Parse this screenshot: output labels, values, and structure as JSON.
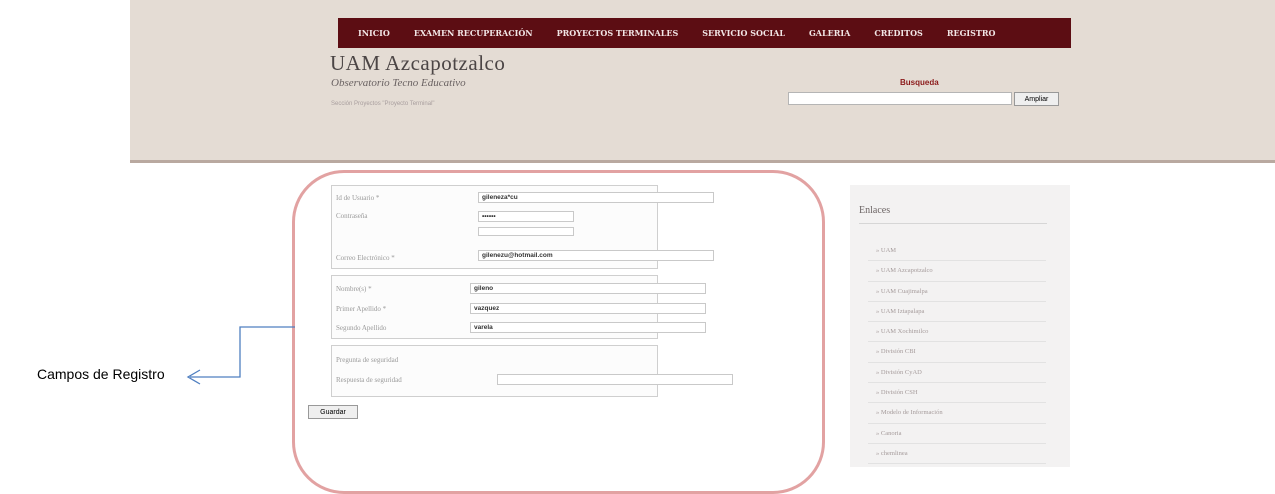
{
  "nav": {
    "items": [
      "INICIO",
      "EXAMEN RECUPERACIÓN",
      "PROYECTOS TERMINALES",
      "SERVICIO SOCIAL",
      "GALERIA",
      "CREDITOS",
      "REGISTRO"
    ]
  },
  "site": {
    "title": "UAM Azcapotzalco",
    "subtitle": "Observatorio Tecno Educativo",
    "small": "Sección Proyectos \"Proyecto Terminal\""
  },
  "search": {
    "label": "Busqueda",
    "value": "",
    "button": "Ampliar"
  },
  "form": {
    "fieldset1": {
      "user_label": "Id de Usuario *",
      "user_value": "gileneza*cu",
      "password_label": "Contraseña",
      "password_value": "••••••",
      "email_label": "Correo Electrónico *",
      "email_value": "gilenezu@hotmail.com"
    },
    "fieldset2": {
      "name_label": "Nombre(s) *",
      "name_value": "gileno",
      "last1_label": "Primer Apellido *",
      "last1_value": "vazquez",
      "last2_label": "Segundo Apellido",
      "last2_value": "varela"
    },
    "fieldset3": {
      "question_label": "Pregunta de seguridad",
      "answer_label": "Respuesta de seguridad",
      "answer_value": ""
    },
    "save_button": "Guardar"
  },
  "sidebar": {
    "title": "Enlaces",
    "items": [
      "» UAM",
      "» UAM Azcapotzalco",
      "» UAM Cuajimalpa",
      "» UAM Iztapalapa",
      "» UAM Xochimilco",
      "» División CBI",
      "» División CyAD",
      "» División CSH",
      "» Modelo de Información",
      "» Canoria",
      "» chemlinea"
    ]
  },
  "annotation": {
    "label": "Campos de Registro"
  },
  "colors": {
    "nav_bg": "#5c0d13",
    "header_bg": "#e4dcd4",
    "highlight": "#e2a2a2",
    "annotation_line": "#4f7fc0"
  }
}
